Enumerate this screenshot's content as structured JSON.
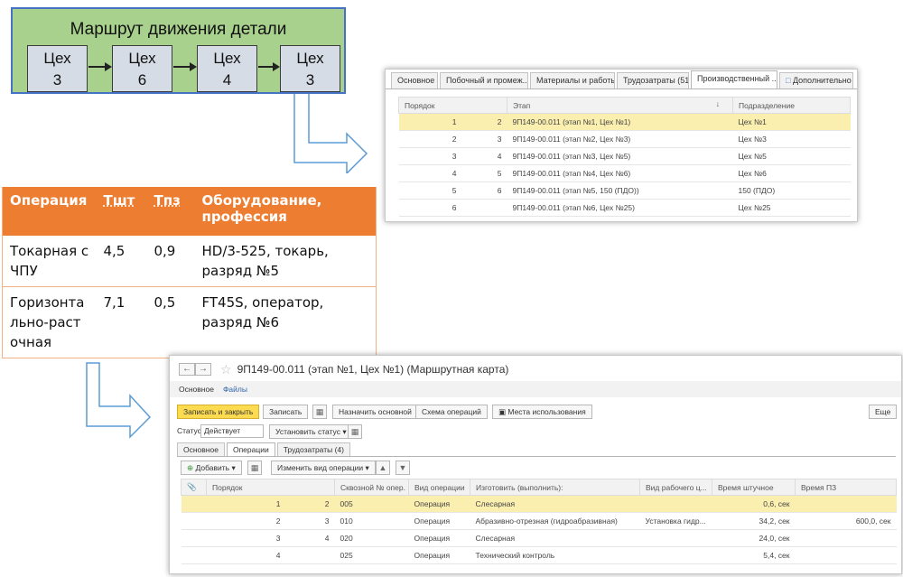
{
  "route": {
    "title": "Маршрут движения детали",
    "shops": [
      {
        "line1": "Цех",
        "line2": "3"
      },
      {
        "line1": "Цех",
        "line2": "6"
      },
      {
        "line1": "Цех",
        "line2": "4"
      },
      {
        "line1": "Цех",
        "line2": "3"
      }
    ]
  },
  "ops_table": {
    "headers": [
      "Операция",
      "Тшт",
      "Тпз",
      "Оборудование, профессия"
    ],
    "rows": [
      [
        "Токарная с ЧПУ",
        "4,5",
        "0,9",
        "HD/3-525, токарь, разряд №5"
      ],
      [
        "Горизонтально-расточная",
        "7,1",
        "0,5",
        "FT45S, оператор, разряд №6"
      ]
    ]
  },
  "win1": {
    "tabs": [
      "Основное",
      "Побочный и промеж...",
      "Материалы и работы...",
      "Трудозатраты (51)",
      "Производственный ...",
      "Дополнительно"
    ],
    "columns": [
      "Порядок",
      "Этап",
      "Подразделение"
    ],
    "sort_arrow": "↓",
    "rows": [
      {
        "order": "1",
        "next": "2",
        "stage": "9П149-00.011 (этап №1, Цех №1)",
        "unit": "Цех №1"
      },
      {
        "order": "2",
        "next": "3",
        "stage": "9П149-00.011 (этап №2, Цех №3)",
        "unit": "Цех №3"
      },
      {
        "order": "3",
        "next": "4",
        "stage": "9П149-00.011 (этап №3, Цех №5)",
        "unit": "Цех №5"
      },
      {
        "order": "4",
        "next": "5",
        "stage": "9П149-00.011 (этап №4, Цех №6)",
        "unit": "Цех №6"
      },
      {
        "order": "5",
        "next": "6",
        "stage": "9П149-00.011 (этап №5, 150 (ПДО))",
        "unit": "150 (ПДО)"
      },
      {
        "order": "6",
        "next": "",
        "stage": "9П149-00.011 (этап №6, Цех №25)",
        "unit": "Цех №25"
      }
    ]
  },
  "win2": {
    "title": "9П149-00.011 (этап №1, Цех №1) (Маршрутная карта)",
    "nav": {
      "back": "←",
      "forward": "→",
      "star": "☆"
    },
    "subnav": [
      "Основное",
      "Файлы"
    ],
    "toolbar": {
      "save_close": "Записать и закрыть",
      "save": "Записать",
      "set_main": "Назначить основной",
      "op_scheme": "Схема операций",
      "usage": "Места использования",
      "more": "Еще"
    },
    "status": {
      "label": "Статус:",
      "value": "Действует",
      "set_button": "Установить статус"
    },
    "tabs": [
      "Основное",
      "Операции",
      "Трудозатраты (4)"
    ],
    "ops_toolbar": {
      "add": "Добавить",
      "change_view": "Изменить вид операции"
    },
    "columns": [
      "Порядок",
      "Сквозной № опер.",
      "Вид операции",
      "Изготовить (выполнить):",
      "Вид рабочего ц...",
      "Время штучное",
      "Время ПЗ"
    ],
    "rows": [
      {
        "order": "1",
        "next": "2",
        "num": "005",
        "kind": "Операция",
        "make": "Слесарная",
        "wc": "",
        "t_piece": "0,6, сек",
        "t_pz": ""
      },
      {
        "order": "2",
        "next": "3",
        "num": "010",
        "kind": "Операция",
        "make": "Абразивно-отрезная (гидроабразивная)",
        "wc": "Установка гидр...",
        "t_piece": "34,2, сек",
        "t_pz": "600,0, сек"
      },
      {
        "order": "3",
        "next": "4",
        "num": "020",
        "kind": "Операция",
        "make": "Слесарная",
        "wc": "",
        "t_piece": "24,0, сек",
        "t_pz": ""
      },
      {
        "order": "4",
        "next": "",
        "num": "025",
        "kind": "Операция",
        "make": "Технический контроль",
        "wc": "",
        "t_piece": "5,4, сек",
        "t_pz": ""
      }
    ]
  },
  "colors": {
    "route_bg": "#a9d18e",
    "route_border": "#4472c4",
    "shop_bg": "#d6dce5",
    "table_header": "#ed7d31",
    "selected_row": "#fbefb0",
    "primary_button": "#fcdb51"
  }
}
